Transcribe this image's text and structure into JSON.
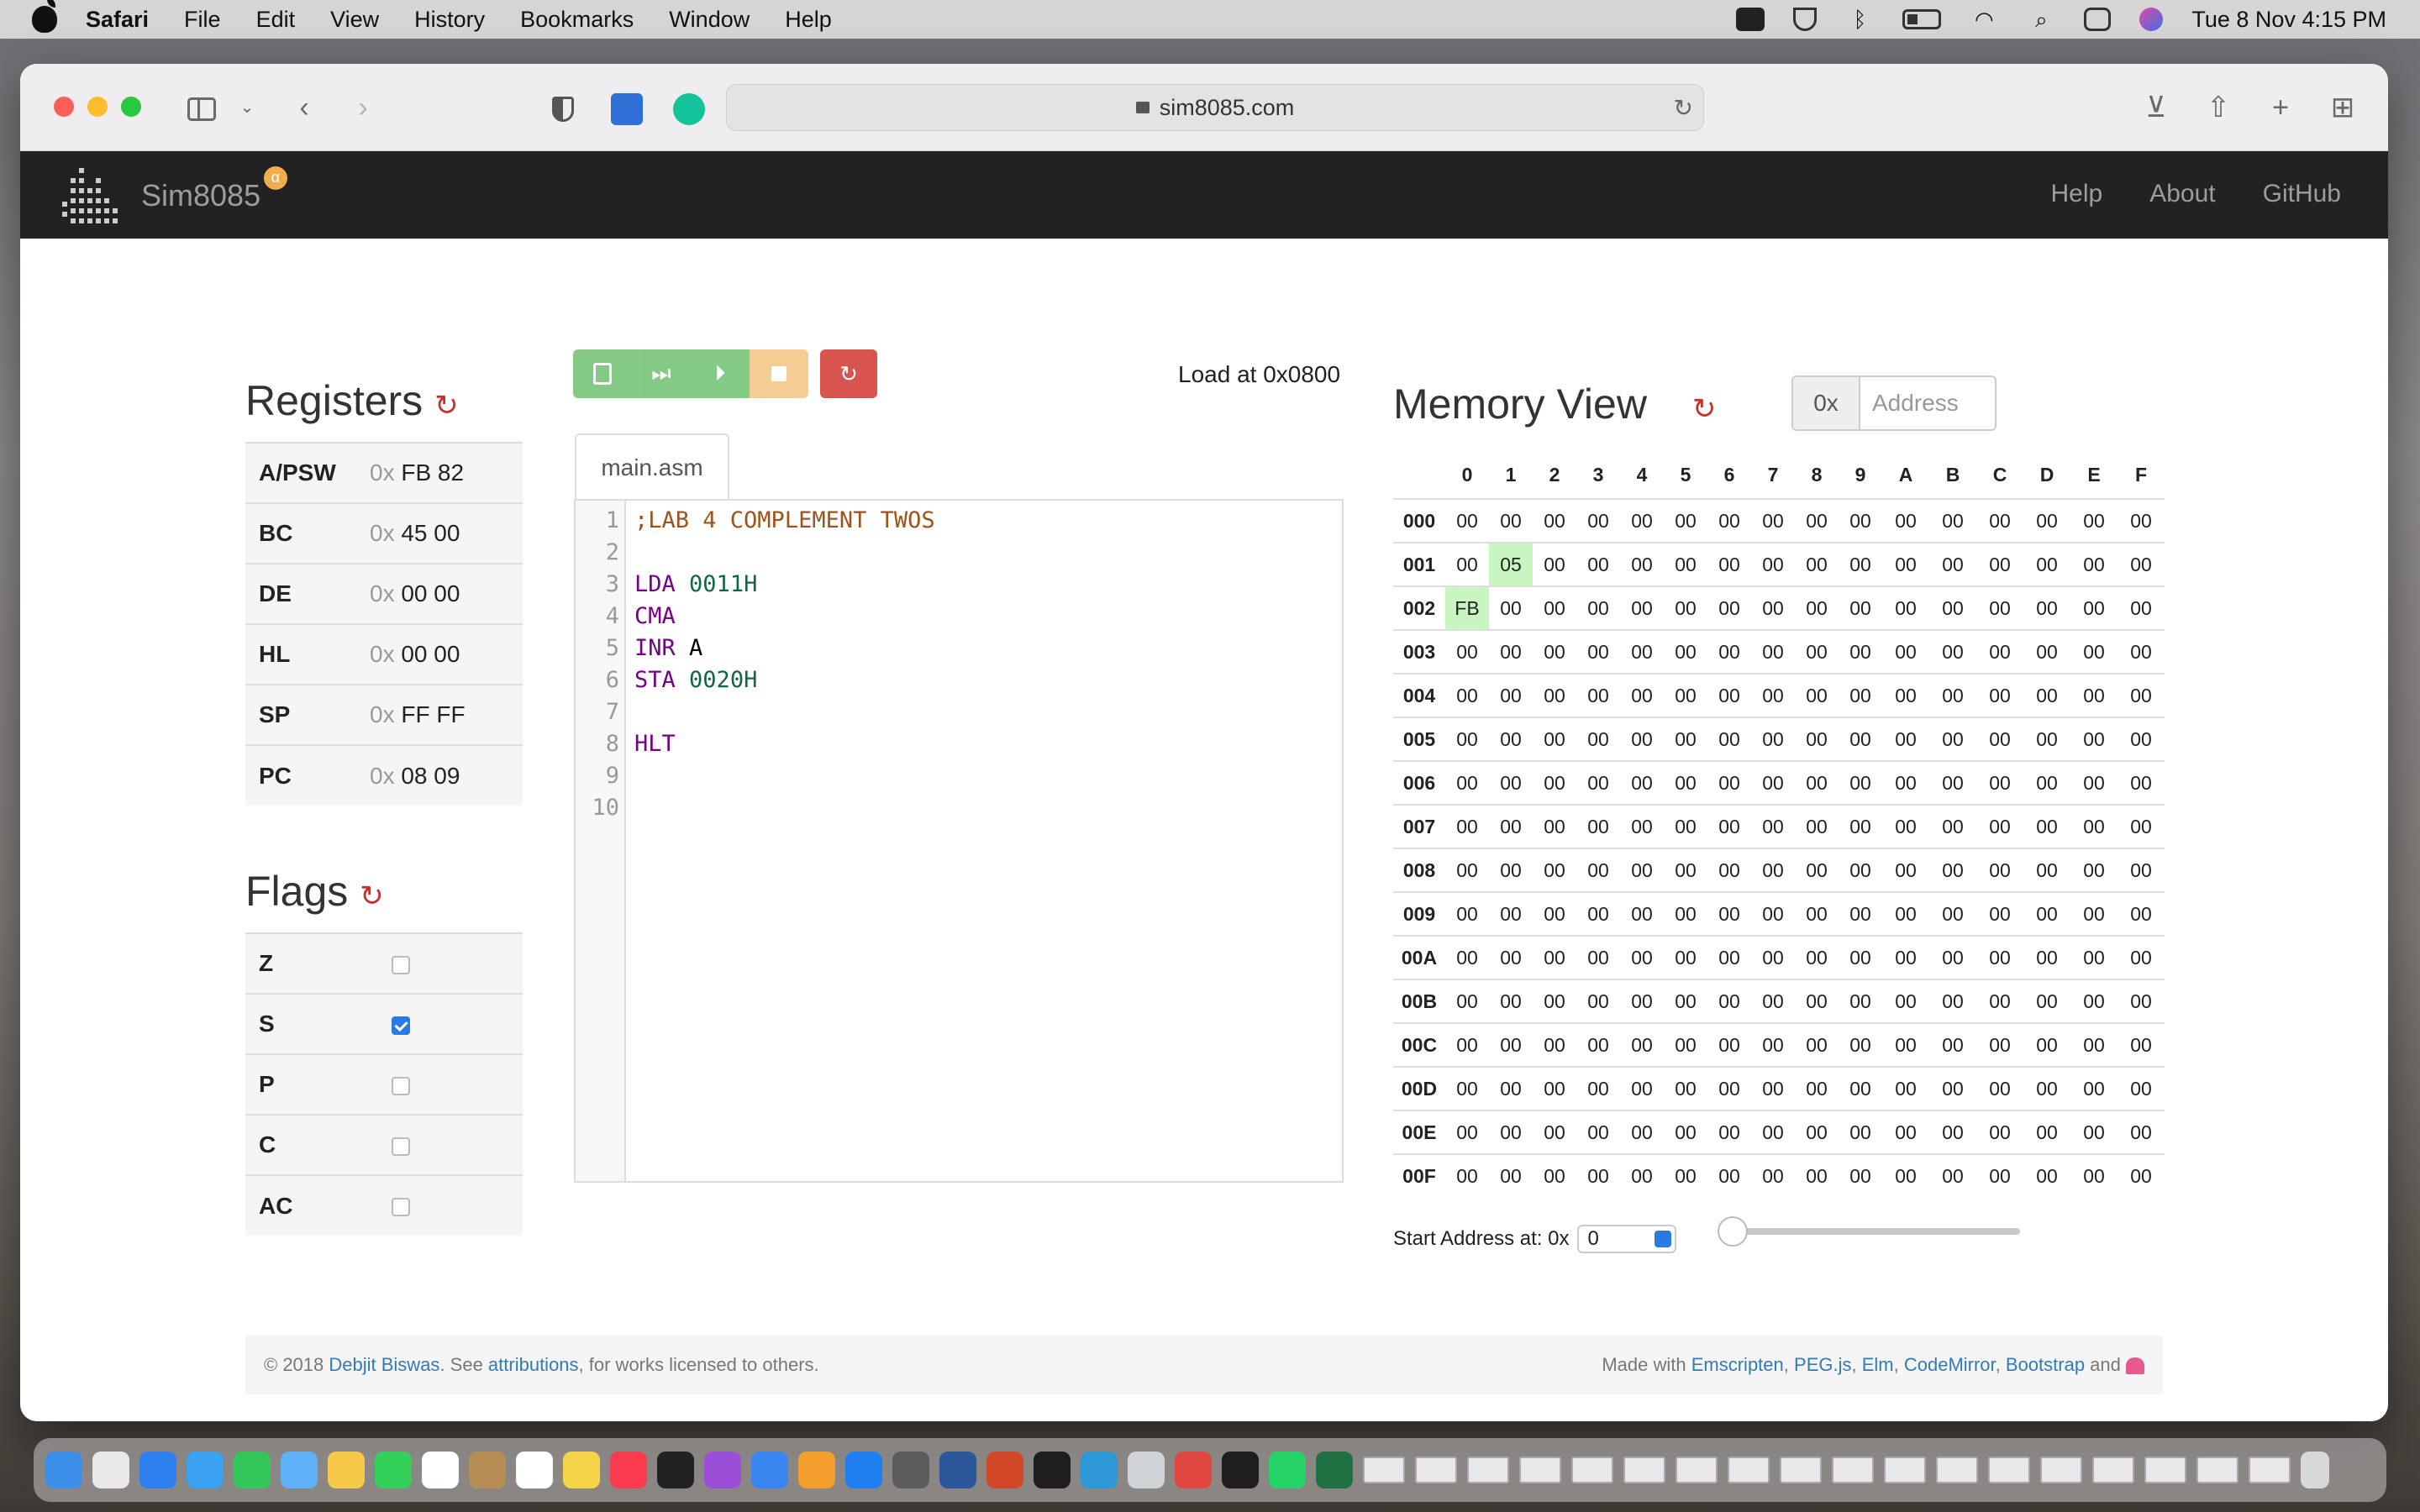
{
  "menubar": {
    "app": "Safari",
    "items": [
      "File",
      "Edit",
      "View",
      "History",
      "Bookmarks",
      "Window",
      "Help"
    ],
    "clock": "Tue 8 Nov  4:15 PM"
  },
  "browser": {
    "url": "sim8085.com"
  },
  "nav": {
    "brand": "Sim8085",
    "badge": "α",
    "links": [
      "Help",
      "About",
      "GitHub"
    ]
  },
  "registers": {
    "title": "Registers",
    "prefix": "0x",
    "rows": [
      {
        "name": "A/PSW",
        "value": "FB 82"
      },
      {
        "name": "BC",
        "value": "45 00"
      },
      {
        "name": "DE",
        "value": "00 00"
      },
      {
        "name": "HL",
        "value": "00 00"
      },
      {
        "name": "SP",
        "value": "FF FF"
      },
      {
        "name": "PC",
        "value": "08 09"
      }
    ]
  },
  "flags": {
    "title": "Flags",
    "rows": [
      {
        "name": "Z",
        "checked": false
      },
      {
        "name": "S",
        "checked": true
      },
      {
        "name": "P",
        "checked": false
      },
      {
        "name": "C",
        "checked": false
      },
      {
        "name": "AC",
        "checked": false
      }
    ]
  },
  "editor": {
    "load_at": "Load at 0x0800",
    "tab": "main.asm",
    "line_numbers": [
      "1",
      "2",
      "3",
      "4",
      "5",
      "6",
      "7",
      "8",
      "9",
      "10"
    ],
    "lines": [
      {
        "op": "",
        "arg": "",
        "comment": ";LAB 4 COMPLEMENT TWOS"
      },
      {
        "op": "",
        "arg": "",
        "comment": ""
      },
      {
        "op": "LDA",
        "arg": "0011H",
        "comment": ""
      },
      {
        "op": "CMA",
        "arg": "",
        "comment": ""
      },
      {
        "op": "INR",
        "arg": "A",
        "comment": ""
      },
      {
        "op": "STA",
        "arg": "0020H",
        "comment": ""
      },
      {
        "op": "",
        "arg": "",
        "comment": ""
      },
      {
        "op": "HLT",
        "arg": "",
        "comment": ""
      },
      {
        "op": "",
        "arg": "",
        "comment": ""
      },
      {
        "op": "",
        "arg": "",
        "comment": ""
      }
    ]
  },
  "memory": {
    "title": "Memory View",
    "addr_prefix": "0x",
    "addr_placeholder": "Address",
    "columns": [
      "0",
      "1",
      "2",
      "3",
      "4",
      "5",
      "6",
      "7",
      "8",
      "9",
      "A",
      "B",
      "C",
      "D",
      "E",
      "F"
    ],
    "row_labels": [
      "000",
      "001",
      "002",
      "003",
      "004",
      "005",
      "006",
      "007",
      "008",
      "009",
      "00A",
      "00B",
      "00C",
      "00D",
      "00E",
      "00F"
    ],
    "nonzero": [
      {
        "row": "001",
        "col": "1",
        "value": "05"
      },
      {
        "row": "002",
        "col": "0",
        "value": "FB"
      }
    ],
    "default_value": "00",
    "start_label": "Start Address at: 0x",
    "start_value": "0",
    "slider_value": 0
  },
  "footer": {
    "left_pre": "© 2018 ",
    "author": "Debjit Biswas",
    "left_mid": ". See ",
    "attributions": "attributions",
    "left_post": ", for works licensed to others.",
    "made_with": "Made with ",
    "libs": [
      "Emscripten",
      "PEG.js",
      "Elm",
      "CodeMirror",
      "Bootstrap"
    ],
    "and": " and "
  }
}
